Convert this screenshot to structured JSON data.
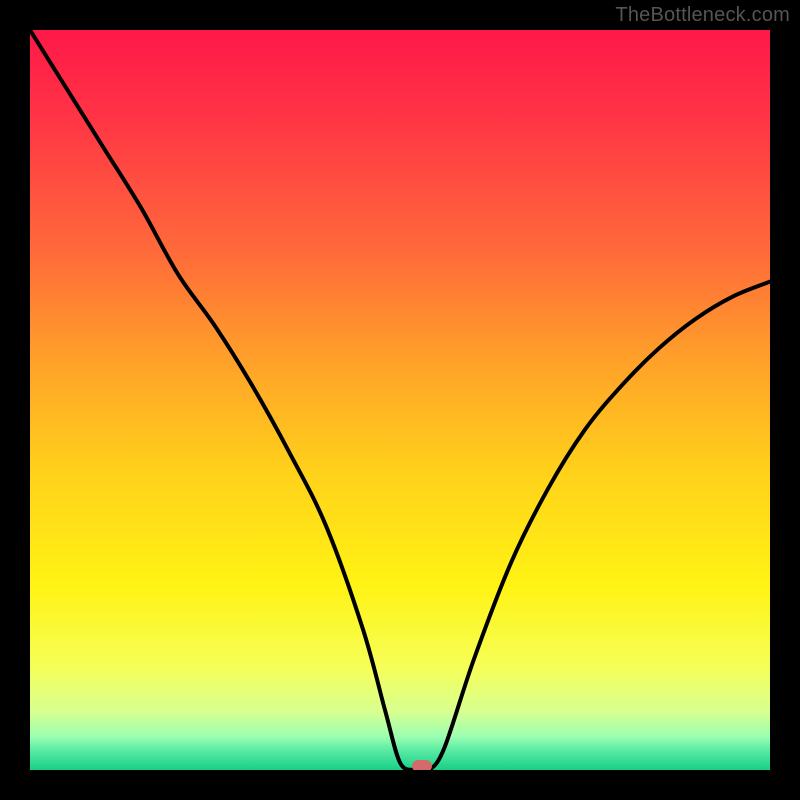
{
  "watermark": "TheBottleneck.com",
  "colors": {
    "black": "#000000",
    "curve": "#000000",
    "marker": "#d56a6a",
    "gradient_stops": [
      {
        "offset": 0.0,
        "color": "#ff1848"
      },
      {
        "offset": 0.12,
        "color": "#ff3545"
      },
      {
        "offset": 0.3,
        "color": "#ff6a3a"
      },
      {
        "offset": 0.45,
        "color": "#ffa229"
      },
      {
        "offset": 0.6,
        "color": "#ffd21a"
      },
      {
        "offset": 0.75,
        "color": "#fff314"
      },
      {
        "offset": 0.86,
        "color": "#f6ff57"
      },
      {
        "offset": 0.92,
        "color": "#d9ff8f"
      },
      {
        "offset": 0.955,
        "color": "#9bffb1"
      },
      {
        "offset": 0.975,
        "color": "#55e9a3"
      },
      {
        "offset": 1.0,
        "color": "#18cf87"
      }
    ]
  },
  "chart_data": {
    "type": "line",
    "title": "",
    "xlabel": "",
    "ylabel": "",
    "xlim": [
      0,
      100
    ],
    "ylim": [
      0,
      100
    ],
    "grid": false,
    "legend": false,
    "series": [
      {
        "name": "bottleneck-curve",
        "x": [
          0,
          5,
          10,
          15,
          20,
          25,
          30,
          35,
          40,
          45,
          48,
          50,
          52,
          53,
          54,
          56,
          60,
          65,
          70,
          75,
          80,
          85,
          90,
          95,
          100
        ],
        "y": [
          100,
          92,
          84,
          76,
          67,
          60,
          52,
          43,
          33,
          19,
          8,
          1,
          0,
          0,
          0,
          3,
          15,
          28,
          38,
          46,
          52,
          57,
          61,
          64,
          66
        ]
      }
    ],
    "annotations": [
      {
        "name": "minimum-point",
        "x": 53,
        "y": 0
      }
    ]
  }
}
